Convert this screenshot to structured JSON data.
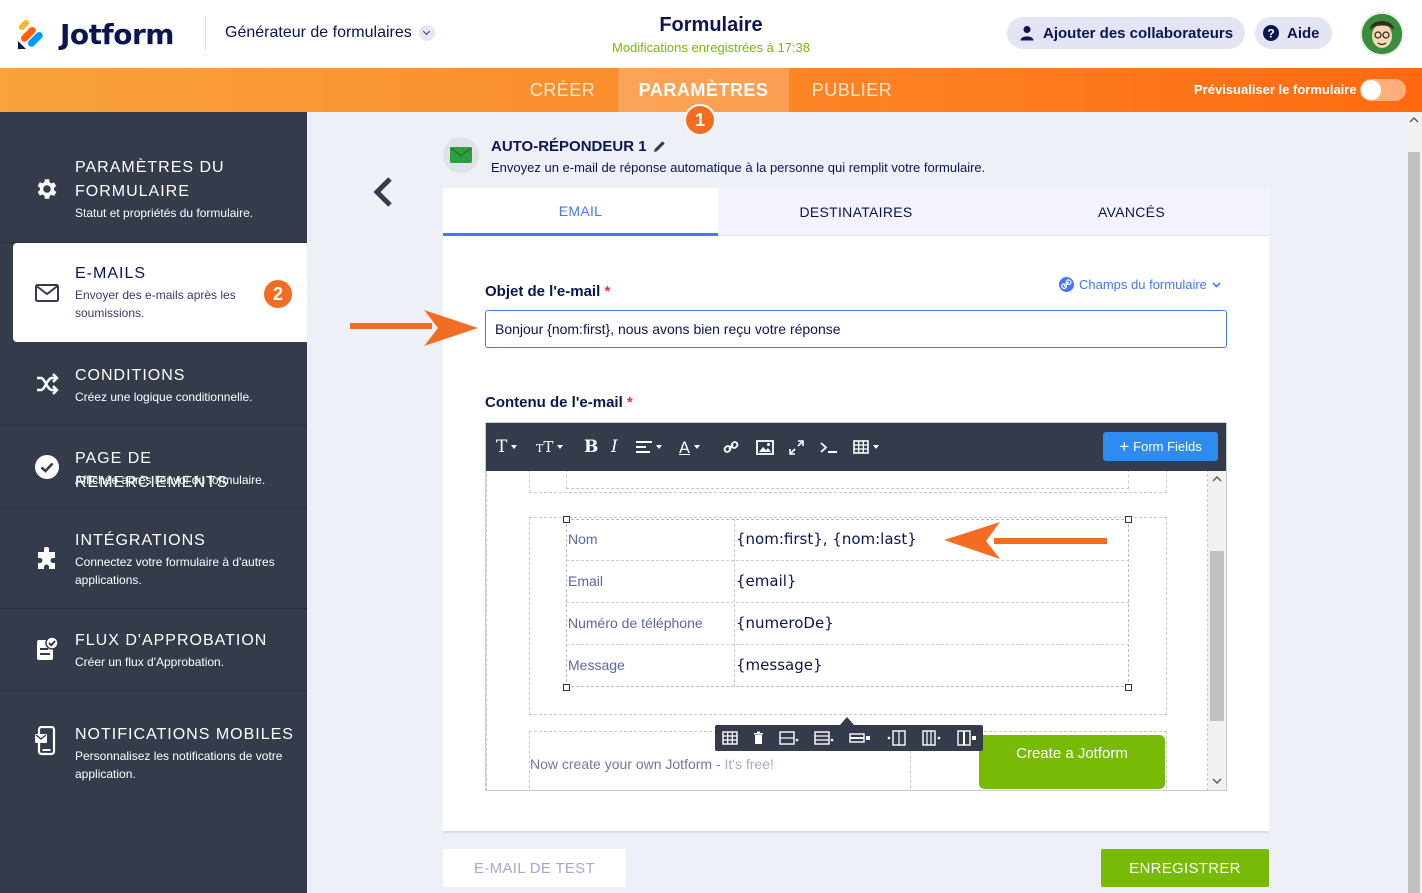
{
  "header": {
    "brand": "Jotform",
    "builder_menu": "Générateur de formulaires",
    "form_title": "Formulaire",
    "save_status": "Modifications enregistrées à 17:38",
    "collaborators_button": "Ajouter des collaborateurs",
    "help_button": "Aide"
  },
  "nav": {
    "tabs": [
      "CRÉER",
      "PARAMÈTRES",
      "PUBLIER"
    ],
    "active_tab": "PARAMÈTRES",
    "preview_label": "Prévisualiser le formulaire",
    "preview_enabled": false,
    "accent_color": "#ff6a10"
  },
  "callouts": {
    "first": "1",
    "second": "2"
  },
  "sidebar": {
    "items": [
      {
        "title_line1": "PARAMÈTRES DU",
        "title_line2": "FORMULAIRE",
        "desc1": "Statut et propriétés du formulaire.",
        "desc2": "",
        "icon": "gear-icon"
      },
      {
        "title_line1": "E-MAILS",
        "title_line2": "",
        "desc1": "Envoyer des e-mails après les",
        "desc2": "soumissions.",
        "icon": "envelope-icon",
        "selected": true
      },
      {
        "title_line1": "CONDITIONS",
        "title_line2": "",
        "desc1": "Créez une logique conditionnelle.",
        "desc2": "",
        "icon": "shuffle-icon"
      },
      {
        "title_line1": "PAGE DE REMERCIEMENTS",
        "title_line2": "",
        "desc1": "Affichée après l'envoi du formulaire.",
        "desc2": "",
        "icon": "check-circle-icon"
      },
      {
        "title_line1": "INTÉGRATIONS",
        "title_line2": "",
        "desc1": "Connectez votre formulaire à d'autres",
        "desc2": "applications.",
        "icon": "puzzle-icon"
      },
      {
        "title_line1": "FLUX D'APPROBATION",
        "title_line2": "",
        "desc1": "Créer un flux d'Approbation.",
        "desc2": "",
        "icon": "approval-icon"
      },
      {
        "title_line1": "NOTIFICATIONS MOBILES",
        "title_line2": "",
        "desc1": "Personnalisez les notifications de votre",
        "desc2": "application.",
        "icon": "mobile-icon"
      }
    ]
  },
  "autoresponder": {
    "title": "AUTO-RÉPONDEUR 1",
    "description": "Envoyez un e-mail de réponse automatique à la personne qui remplit votre formulaire."
  },
  "card_tabs": [
    "EMAIL",
    "DESTINATAIRES",
    "AVANCÉS"
  ],
  "subject": {
    "label": "Objet de l'e-mail",
    "required_mark": "*",
    "form_fields_link": "Champs du formulaire",
    "value": "Bonjour {nom:first}, nous avons bien reçu votre réponse"
  },
  "content": {
    "label": "Contenu de l'e-mail",
    "required_mark": "*",
    "form_fields_button": "Form Fields",
    "rows": [
      {
        "key": "Nom",
        "value": "{nom:first}, {nom:last}"
      },
      {
        "key": "Email",
        "value": "{email}"
      },
      {
        "key": "Numéro de téléphone",
        "value": "{numeroDe}"
      },
      {
        "key": "Message",
        "value": "{message}"
      }
    ],
    "promo_text": "Now create your own Jotform - ",
    "promo_free": "It's free!",
    "cta_button": "Create a Jotform"
  },
  "footer": {
    "test_button": "E-MAIL DE TEST",
    "save_button": "ENREGISTRER"
  }
}
